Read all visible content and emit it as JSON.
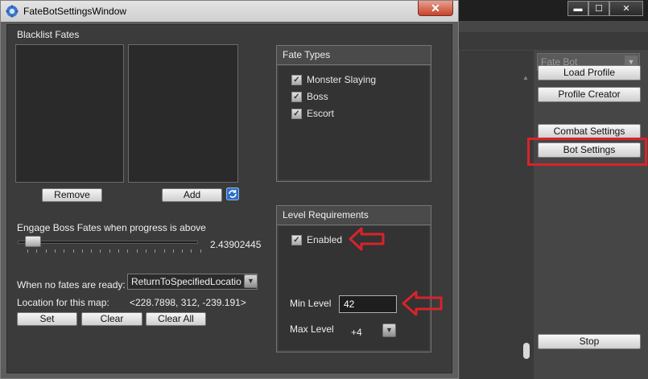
{
  "dialog": {
    "title": "FateBotSettingsWindow",
    "close_glyph": "✕"
  },
  "blacklist": {
    "label": "Blacklist Fates",
    "remove_label": "Remove",
    "add_label": "Add"
  },
  "boss_progress": {
    "label": "Engage Boss Fates when progress is above",
    "value_text": "2.43902445",
    "value_fraction": 0.024
  },
  "no_fates": {
    "label": "When no fates are ready:",
    "selected": "ReturnToSpecifiedLocatio"
  },
  "location": {
    "label": "Location for this map:",
    "value": "<228.7898, 312, -239.191>",
    "set_label": "Set",
    "clear_label": "Clear",
    "clear_all_label": "Clear All"
  },
  "fate_types": {
    "header": "Fate Types",
    "items": [
      {
        "label": "Monster Slaying",
        "checked": true
      },
      {
        "label": "Boss",
        "checked": true
      },
      {
        "label": "Escort",
        "checked": true
      }
    ]
  },
  "level_requirements": {
    "header": "Level Requirements",
    "enabled_label": "Enabled",
    "min_label": "Min Level",
    "min_value": "42",
    "max_label": "Max Level",
    "max_value": "+4"
  },
  "main_window": {
    "minimize_glyph": "▬",
    "maximize_glyph": "☐",
    "close_glyph": "✕",
    "botbase_selected": "Fate Bot",
    "load_profile_label": "Load Profile",
    "profile_creator_label": "Profile Creator",
    "combat_settings_label": "Combat Settings",
    "bot_settings_label": "Bot Settings",
    "stop_label": "Stop"
  },
  "colors": {
    "annotation_red": "#d9232a",
    "dialog_bg": "#3b3b3b"
  },
  "icons": {
    "dialog_icon": "gear-robot-icon",
    "refresh_icon": "refresh-icon",
    "check_icon": "check-icon"
  }
}
